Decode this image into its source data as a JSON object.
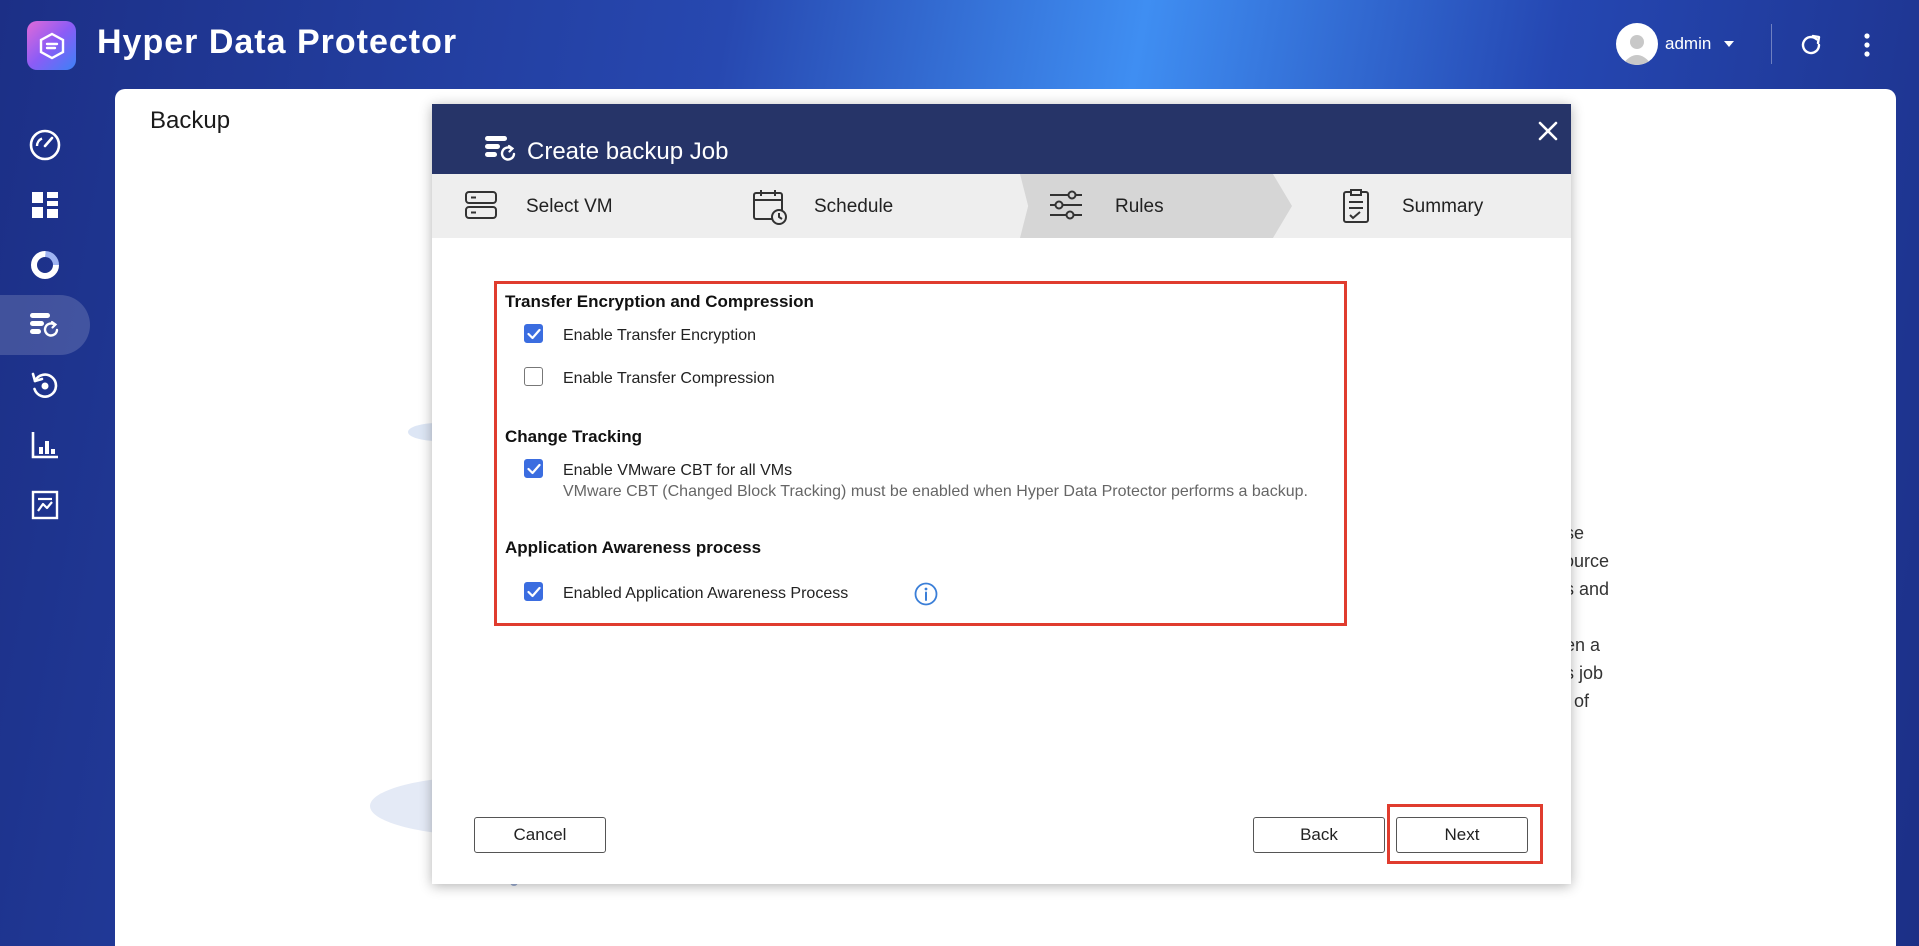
{
  "header": {
    "title": "Hyper Data Protector",
    "user": "admin"
  },
  "sidebar": {
    "items": [
      {
        "icon": "dashboard-gauge-icon"
      },
      {
        "icon": "overview-grid-icon"
      },
      {
        "icon": "storage-ring-icon"
      },
      {
        "icon": "backup-icon",
        "active": true
      },
      {
        "icon": "restore-icon"
      },
      {
        "icon": "report-chart-icon"
      },
      {
        "icon": "log-document-icon"
      }
    ]
  },
  "page": {
    "title": "Backup",
    "bg_lines": [
      "ase",
      "source",
      "es and",
      "hen a",
      "ds job",
      "st of"
    ]
  },
  "modal": {
    "title": "Create backup Job",
    "steps": [
      {
        "label": "Select VM"
      },
      {
        "label": "Schedule"
      },
      {
        "label": "Rules",
        "active": true
      },
      {
        "label": "Summary"
      }
    ],
    "sections": {
      "transfer": {
        "title": "Transfer Encryption and Compression",
        "encryption_label": "Enable Transfer Encryption",
        "encryption_checked": true,
        "compression_label": "Enable Transfer Compression",
        "compression_checked": false
      },
      "tracking": {
        "title": "Change Tracking",
        "cbt_label": "Enable VMware CBT for all VMs",
        "cbt_checked": true,
        "cbt_desc": "VMware CBT (Changed Block Tracking) must be enabled when Hyper Data Protector performs a backup."
      },
      "awareness": {
        "title": "Application Awareness process",
        "label": "Enabled Application Awareness Process",
        "checked": true
      }
    },
    "buttons": {
      "cancel": "Cancel",
      "back": "Back",
      "next": "Next"
    }
  },
  "colors": {
    "accent": "#3b6de0",
    "highlight": "#e03c2e",
    "modal_header": "#263468"
  }
}
